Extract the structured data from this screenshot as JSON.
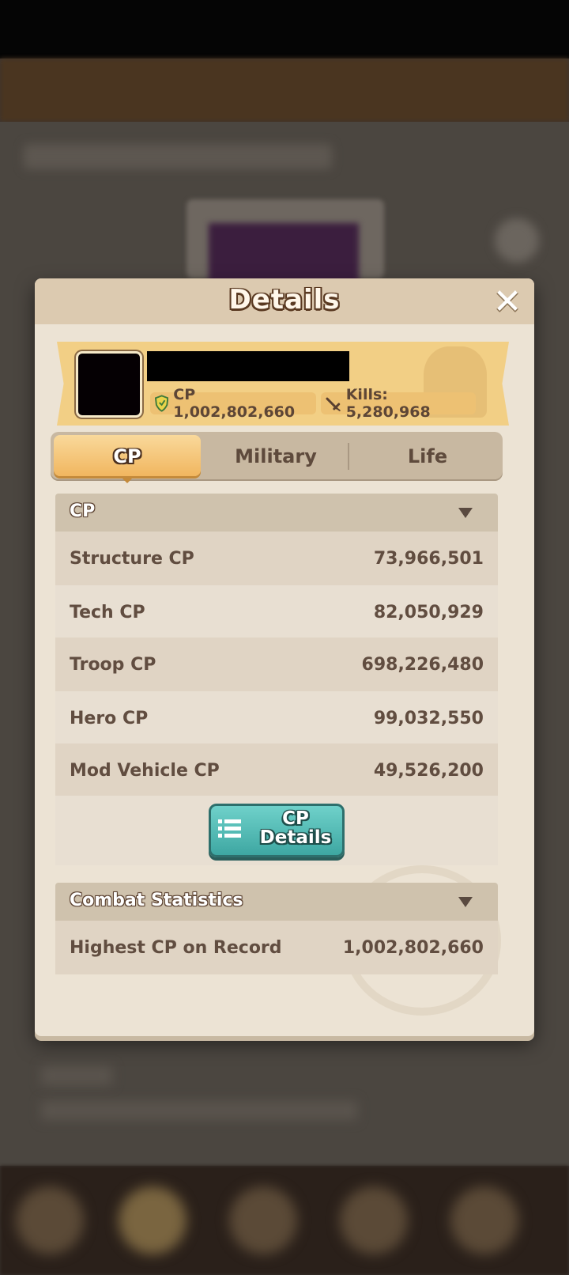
{
  "dialog": {
    "title": "Details",
    "close_icon": "close-icon"
  },
  "player": {
    "cp_label": "CP 1,002,802,660",
    "kills_label": "Kills:  5,280,968",
    "shield_icon": "shield-icon",
    "kills_icon": "sword-icon"
  },
  "tabs": [
    {
      "label": "CP",
      "active": true
    },
    {
      "label": "Military",
      "active": false
    },
    {
      "label": "Life",
      "active": false
    }
  ],
  "cp_section": {
    "title": "CP",
    "rows": [
      {
        "label": "Structure CP",
        "value": "73,966,501"
      },
      {
        "label": "Tech CP",
        "value": "82,050,929"
      },
      {
        "label": "Troop CP",
        "value": "698,226,480"
      },
      {
        "label": "Hero CP",
        "value": "99,032,550"
      },
      {
        "label": "Mod Vehicle CP",
        "value": "49,526,200"
      }
    ],
    "details_button": {
      "line1": "CP",
      "line2": "Details"
    }
  },
  "combat_section": {
    "title": "Combat Statistics",
    "rows": [
      {
        "label": "Highest CP on Record",
        "value": "1,002,802,660"
      }
    ]
  },
  "colors": {
    "accent_tab": "#f1b65f",
    "button_teal": "#3ea7a2",
    "panel": "#ece3d4",
    "text_brown": "#614d40"
  }
}
